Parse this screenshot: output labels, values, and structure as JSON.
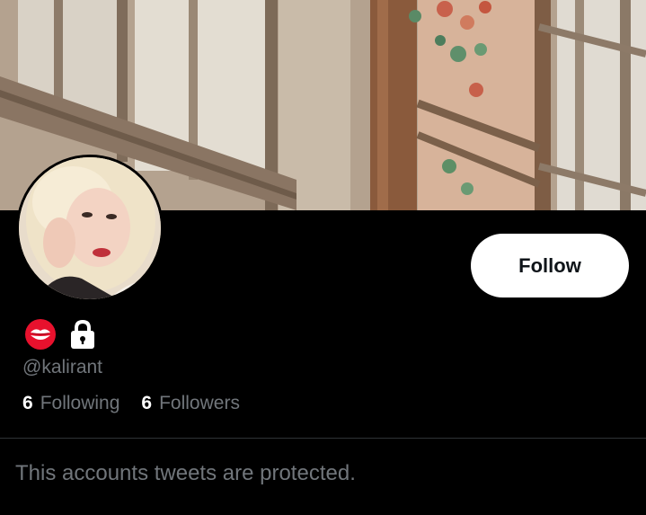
{
  "profile": {
    "display_name_icons": [
      "kiss-mark-icon",
      "lock-icon"
    ],
    "handle": "@kalirant",
    "follow_label": "Follow"
  },
  "stats": {
    "following_count": "6",
    "following_label": "Following",
    "followers_count": "6",
    "followers_label": "Followers"
  },
  "protected_message": "This accounts tweets are protected.",
  "colors": {
    "background": "#000000",
    "text_primary": "#ffffff",
    "text_secondary": "#71767b",
    "divider": "#2f3336",
    "button_bg": "#ffffff",
    "button_text": "#0f1419"
  }
}
